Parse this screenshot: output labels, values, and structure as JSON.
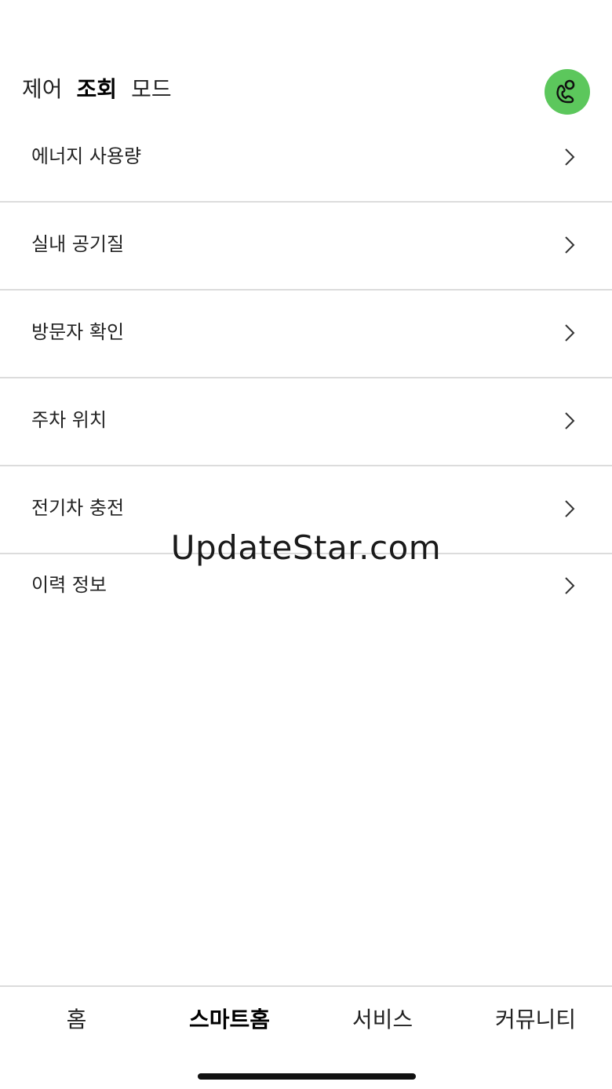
{
  "header": {
    "mode_tabs": [
      {
        "label": "제어",
        "active": false
      },
      {
        "label": "조회",
        "active": true
      },
      {
        "label": "모드",
        "active": false
      }
    ],
    "call_icon": "phone-call-icon",
    "call_color": "#5cc75c"
  },
  "menu": {
    "items": [
      {
        "label": "에너지 사용량"
      },
      {
        "label": "실내 공기질"
      },
      {
        "label": "방문자 확인"
      },
      {
        "label": "주차 위치"
      },
      {
        "label": "전기차 충전"
      },
      {
        "label": "이력 정보"
      }
    ],
    "chevron_icon": "chevron-right-icon"
  },
  "watermark": {
    "text": "UpdateStar.com"
  },
  "bottom_nav": {
    "items": [
      {
        "label": "홈",
        "active": false
      },
      {
        "label": "스마트홈",
        "active": true
      },
      {
        "label": "서비스",
        "active": false
      },
      {
        "label": "커뮤니티",
        "active": false
      }
    ]
  }
}
